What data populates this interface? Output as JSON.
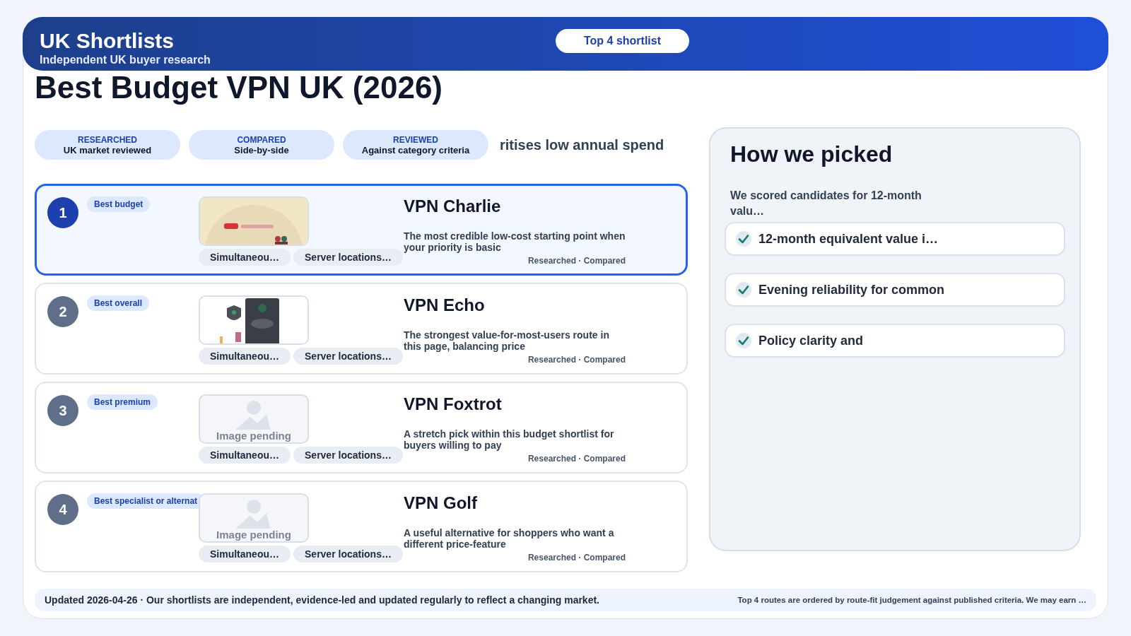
{
  "header": {
    "brand": "UK Shortlists",
    "tagline": "Independent UK buyer research",
    "button": "Top 4 shortlist"
  },
  "title": "Best Budget VPN UK (2026)",
  "badges": [
    {
      "label": "RESEARCHED",
      "value": "UK market reviewed"
    },
    {
      "label": "COMPARED",
      "value": "Side-by-side"
    },
    {
      "label": "REVIEWED",
      "value": "Against category criteria"
    }
  ],
  "intro": "ritises low annual spend",
  "products": [
    {
      "rank": "1",
      "tag": "Best budget",
      "selected": true,
      "image": {
        "kind": "picture"
      },
      "chips": [
        "Simultaneou…",
        "Server locations…"
      ],
      "name": "VPN Charlie",
      "description": "The most credible low-cost starting point when your priority is basic",
      "meta": "Researched · Compared"
    },
    {
      "rank": "2",
      "tag": "Best overall",
      "selected": false,
      "image": {
        "kind": "picture"
      },
      "chips": [
        "Simultaneou…",
        "Server locations…"
      ],
      "name": "VPN Echo",
      "description": "The strongest value-for-most-users route in this page, balancing price",
      "meta": "Researched · Compared"
    },
    {
      "rank": "3",
      "tag": "Best premium",
      "selected": false,
      "image": {
        "kind": "placeholder",
        "caption": "Image pending"
      },
      "chips": [
        "Simultaneou…",
        "Server locations…"
      ],
      "name": "VPN Foxtrot",
      "description": "A stretch pick within this budget shortlist for buyers willing to pay",
      "meta": "Researched · Compared"
    },
    {
      "rank": "4",
      "tag": "Best specialist or alternat",
      "selected": false,
      "image": {
        "kind": "placeholder",
        "caption": "Image pending"
      },
      "chips": [
        "Simultaneou…",
        "Server locations…"
      ],
      "name": "VPN Golf",
      "description": "A useful alternative for shoppers who want a different price-feature",
      "meta": "Researched · Compared"
    }
  ],
  "method": {
    "title": "How we picked",
    "subtitle": "We scored candidates for 12-month valu…",
    "criteria": [
      {
        "text": "12-month equivalent value i…",
        "checked": true
      },
      {
        "text": "Evening reliability for common",
        "checked": true
      },
      {
        "text": "Policy clarity and",
        "checked": true
      }
    ]
  },
  "footer": {
    "updated": "Updated 2026-04-26 · Our shortlists are independent, evidence-led and updated regularly to reflect a changing market.",
    "note": "Top 4 routes are ordered by route-fit judgement against published criteria. We may earn …"
  }
}
